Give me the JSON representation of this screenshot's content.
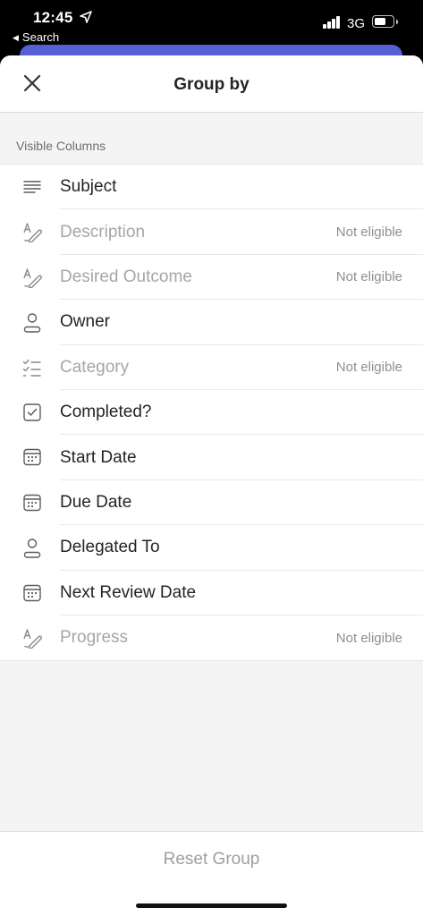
{
  "status_bar": {
    "time": "12:45",
    "back_label": "Search",
    "network": "3G"
  },
  "header": {
    "title": "Group by",
    "close_icon": "close-icon"
  },
  "section": {
    "label": "Visible Columns"
  },
  "columns": [
    {
      "label": "Subject",
      "icon": "text-lines-icon",
      "eligible": true,
      "note": ""
    },
    {
      "label": "Description",
      "icon": "text-pen-icon",
      "eligible": false,
      "note": "Not eligible"
    },
    {
      "label": "Desired Outcome",
      "icon": "text-pen-icon",
      "eligible": false,
      "note": "Not eligible"
    },
    {
      "label": "Owner",
      "icon": "person-icon",
      "eligible": true,
      "note": ""
    },
    {
      "label": "Category",
      "icon": "checklist-icon",
      "eligible": false,
      "note": "Not eligible"
    },
    {
      "label": "Completed?",
      "icon": "checkbox-icon",
      "eligible": true,
      "note": ""
    },
    {
      "label": "Start Date",
      "icon": "calendar-icon",
      "eligible": true,
      "note": ""
    },
    {
      "label": "Due Date",
      "icon": "calendar-icon",
      "eligible": true,
      "note": ""
    },
    {
      "label": "Delegated To",
      "icon": "person-icon",
      "eligible": true,
      "note": ""
    },
    {
      "label": "Next Review Date",
      "icon": "calendar-icon",
      "eligible": true,
      "note": ""
    },
    {
      "label": "Progress",
      "icon": "text-pen-icon",
      "eligible": false,
      "note": "Not eligible"
    }
  ],
  "footer": {
    "reset_label": "Reset Group"
  },
  "colors": {
    "accent_card": "#5560d4",
    "text_primary": "#242424",
    "text_disabled": "#a6a6a6"
  }
}
